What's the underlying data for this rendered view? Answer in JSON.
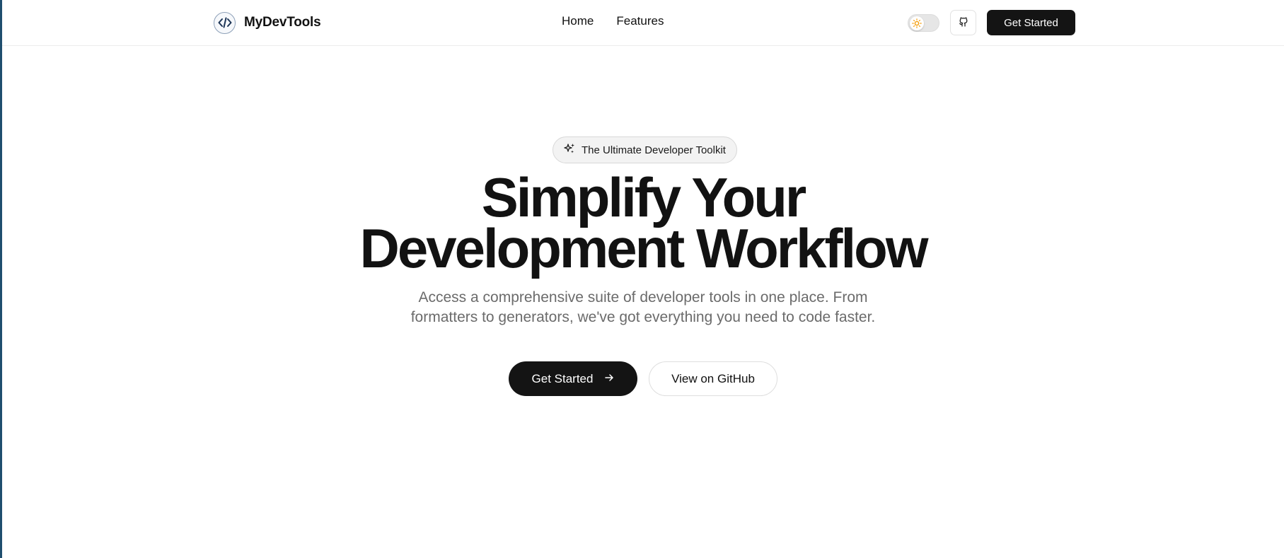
{
  "navbar": {
    "brand_name": "MyDevTools",
    "logo_icon": "code-brackets-icon",
    "links": [
      {
        "label": "Home"
      },
      {
        "label": "Features"
      }
    ],
    "theme_toggle_icon": "sun-icon",
    "github_icon": "github-icon",
    "cta_label": "Get Started"
  },
  "hero": {
    "badge_icon": "sparkles-icon",
    "badge_text": "The Ultimate Developer Toolkit",
    "headline_line1": "Simplify Your",
    "headline_line2": "Development Workflow",
    "subhead_line1": "Access a comprehensive suite of developer tools in one place. From",
    "subhead_line2": "formatters to generators, we've got everything you need to code faster.",
    "primary_button": "Get Started",
    "primary_button_icon": "arrow-right-icon",
    "secondary_button": "View on GitHub"
  },
  "colors": {
    "primary": "#141414",
    "muted_text": "#6b6b6b",
    "toggle_sun": "#f59e0b"
  }
}
